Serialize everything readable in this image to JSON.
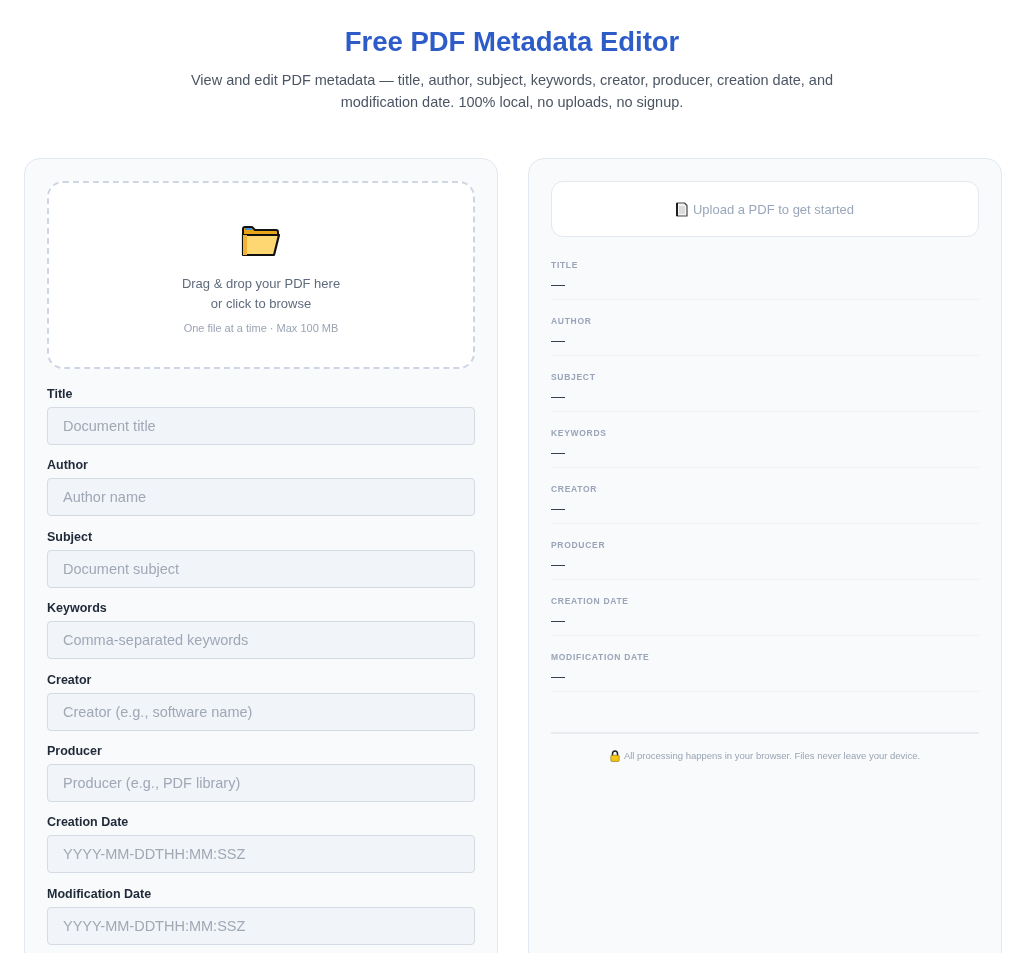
{
  "header": {
    "title": "Free PDF Metadata Editor",
    "subtitle": "View and edit PDF metadata — title, author, subject, keywords, creator, producer, creation date, and modification date. 100% local, no uploads, no signup."
  },
  "upload": {
    "prompt": "Drag & drop your PDF here",
    "browse": "or click to browse",
    "hint": "One file at a time · Max 100 MB"
  },
  "form_fields": [
    {
      "label": "Title",
      "placeholder": "Document title"
    },
    {
      "label": "Author",
      "placeholder": "Author name"
    },
    {
      "label": "Subject",
      "placeholder": "Document subject"
    },
    {
      "label": "Keywords",
      "placeholder": "Comma-separated keywords"
    },
    {
      "label": "Creator",
      "placeholder": "Creator (e.g., software name)"
    },
    {
      "label": "Producer",
      "placeholder": "Producer (e.g., PDF library)"
    },
    {
      "label": "Creation Date",
      "placeholder": "YYYY-MM-DDTHH:MM:SSZ"
    },
    {
      "label": "Modification Date",
      "placeholder": "YYYY-MM-DDTHH:MM:SSZ"
    }
  ],
  "preview": {
    "status": "Upload a PDF to get started",
    "fields": [
      {
        "label": "TITLE",
        "value": "—"
      },
      {
        "label": "AUTHOR",
        "value": "—"
      },
      {
        "label": "SUBJECT",
        "value": "—"
      },
      {
        "label": "KEYWORDS",
        "value": "—"
      },
      {
        "label": "CREATOR",
        "value": "—"
      },
      {
        "label": "PRODUCER",
        "value": "—"
      },
      {
        "label": "CREATION DATE",
        "value": "—"
      },
      {
        "label": "MODIFICATION DATE",
        "value": "—"
      }
    ],
    "privacy_note": "All processing happens in your browser. Files never leave your device."
  }
}
